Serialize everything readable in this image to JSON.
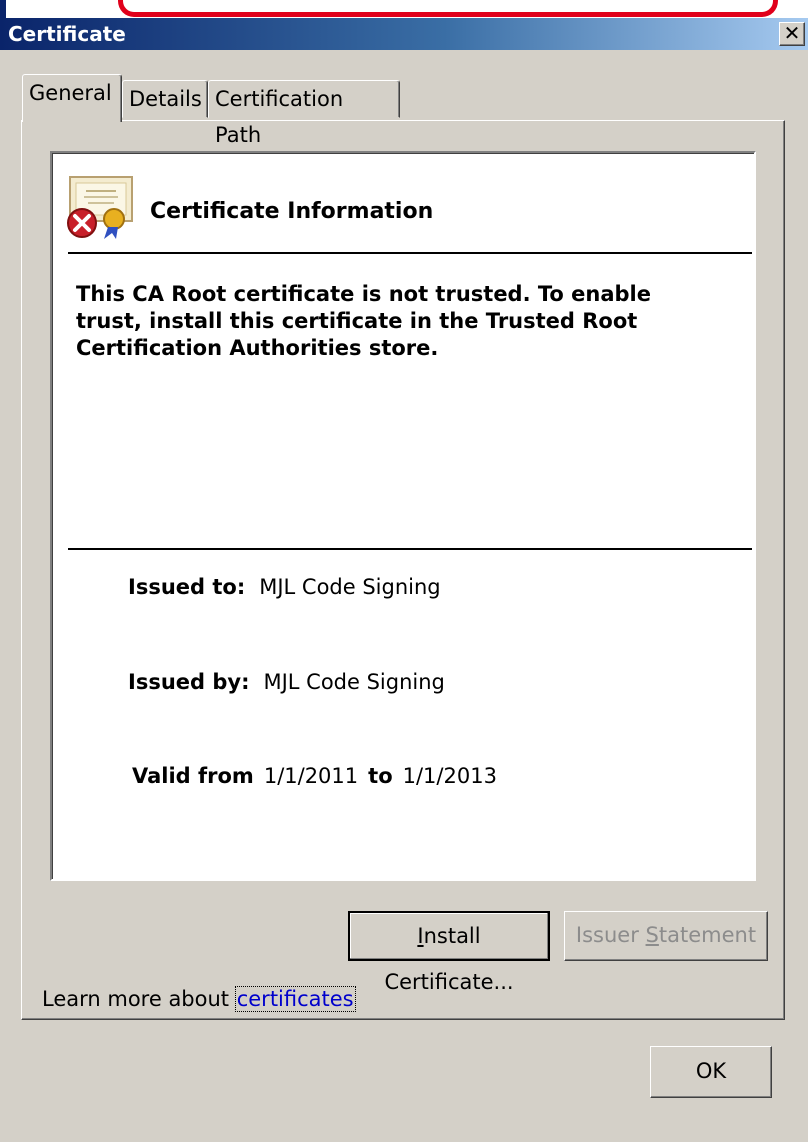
{
  "window": {
    "title": "Certificate",
    "close_label": "✕"
  },
  "tabs": [
    {
      "label": "General",
      "active": true
    },
    {
      "label": "Details",
      "active": false
    },
    {
      "label": "Certification Path",
      "active": false
    }
  ],
  "info": {
    "heading": "Certificate Information",
    "message": "This CA Root certificate is not trusted. To enable trust, install this certificate in the Trusted Root Certification Authorities store.",
    "issued_to_label": "Issued to:",
    "issued_to": "MJL Code Signing",
    "issued_by_label": "Issued by:",
    "issued_by": "MJL Code Signing",
    "valid_from_label": "Valid from",
    "valid_from": "1/1/2011",
    "to_label": "to",
    "valid_to": "1/1/2013"
  },
  "buttons": {
    "install_prefix": "I",
    "install_rest": "nstall Certificate...",
    "issuer_prefix": "Issuer ",
    "issuer_u": "S",
    "issuer_rest": "tatement",
    "ok": "OK"
  },
  "learn_more": {
    "prefix": "Learn more about ",
    "link": "certificates"
  },
  "colors": {
    "title_start": "#0a246a",
    "title_end": "#a6caf0",
    "highlight": "#e0001b",
    "link": "#0000cc"
  }
}
